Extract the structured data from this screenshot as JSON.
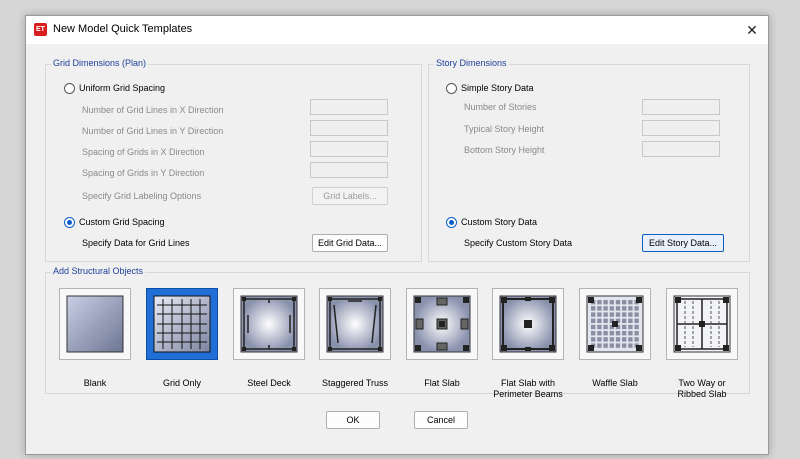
{
  "window": {
    "title": "New Model Quick Templates",
    "icon": "etabs-app-icon",
    "close": "✕"
  },
  "grid": {
    "title": "Grid Dimensions (Plan)",
    "uniform_label": "Uniform Grid Spacing",
    "fields": [
      "Number of Grid Lines in X Direction",
      "Number of Grid Lines in Y Direction",
      "Spacing of Grids in X Direction",
      "Spacing of Grids in Y Direction"
    ],
    "labeling_label": "Specify Grid Labeling Options",
    "grid_labels_button": "Grid Labels...",
    "custom_label": "Custom Grid Spacing",
    "custom_spec_label": "Specify Data for Grid Lines",
    "edit_button": "Edit Grid Data...",
    "selected": "custom"
  },
  "story": {
    "title": "Story Dimensions",
    "simple_label": "Simple Story Data",
    "fields": [
      "Number of Stories",
      "Typical Story Height",
      "Bottom Story Height"
    ],
    "custom_label": "Custom Story Data",
    "custom_spec_label": "Specify Custom Story Data",
    "edit_button": "Edit Story Data...",
    "selected": "custom"
  },
  "objects": {
    "title": "Add Structural Objects",
    "selected": "Grid Only",
    "items": [
      {
        "l1": "Blank",
        "l2": ""
      },
      {
        "l1": "Grid Only",
        "l2": ""
      },
      {
        "l1": "Steel Deck",
        "l2": ""
      },
      {
        "l1": "Staggered Truss",
        "l2": ""
      },
      {
        "l1": "Flat Slab",
        "l2": ""
      },
      {
        "l1": "Flat Slab with",
        "l2": "Perimeter Beams"
      },
      {
        "l1": "Waffle Slab",
        "l2": ""
      },
      {
        "l1": "Two Way or",
        "l2": "Ribbed Slab"
      }
    ]
  },
  "buttons": {
    "ok": "OK",
    "cancel": "Cancel"
  },
  "colors": {
    "accent": "#0b5ec9",
    "group_title": "#1e3f9a",
    "selected_tile": "#1f6fd6"
  }
}
